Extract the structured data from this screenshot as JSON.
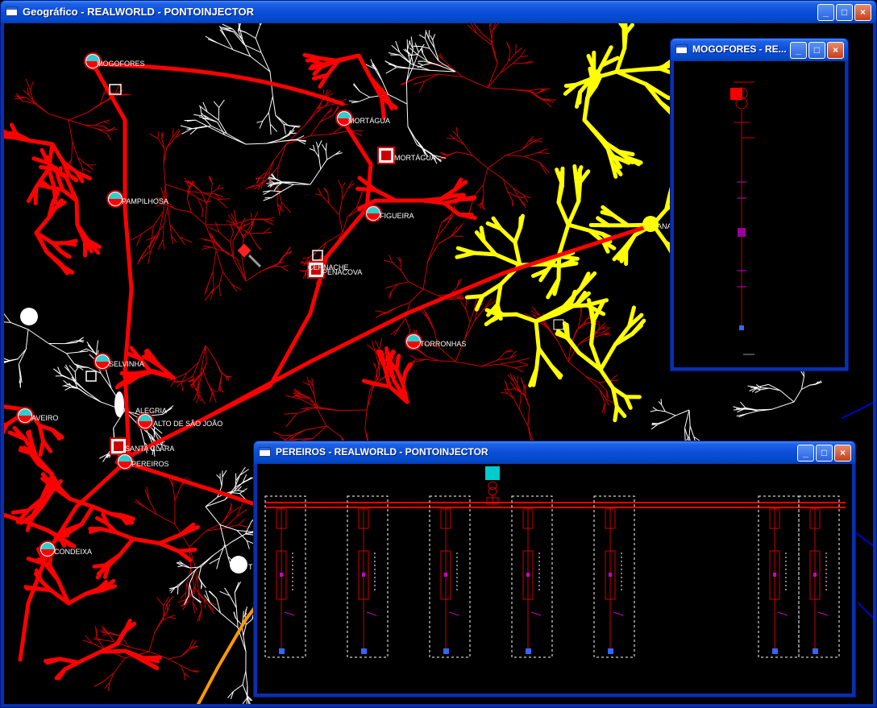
{
  "main_window": {
    "title": "Geográfico - REALWORLD - PONTOINJECTOR",
    "buttons": {
      "minimize": "_",
      "maximize": "□",
      "close": "×"
    }
  },
  "map": {
    "substations": [
      {
        "label": "MOGOFORES"
      },
      {
        "label": "MORTÁGUA"
      },
      {
        "label": "MORTÁGUA"
      },
      {
        "label": "ANADIA"
      },
      {
        "label": "PAMPILHOSA"
      },
      {
        "label": "FIGUEIRA"
      },
      {
        "label": "PENACOVA"
      },
      {
        "label": "CERNACHE"
      },
      {
        "label": "TORRONHAS"
      },
      {
        "label": "SELVINHA"
      },
      {
        "label": "ALEGRIA"
      },
      {
        "label": "AVEIRO"
      },
      {
        "label": "ALTO DE SÃO JOÃO"
      },
      {
        "label": "SANTA CLARA"
      },
      {
        "label": "PEREIROS"
      },
      {
        "label": "CONDEIXA"
      },
      {
        "label": "TUF"
      }
    ],
    "colors": {
      "network": "#ff0000",
      "highlight": "#ffff00",
      "lowvoltage": "#ffffff",
      "substation_fill": "#33cccc",
      "orange_line": "#ff9900",
      "blue_line": "#0000cc"
    }
  },
  "mogofores_window": {
    "title": "MOGOFORES - RE...",
    "buttons": {
      "minimize": "_",
      "maximize": "□",
      "close": "×"
    }
  },
  "pereiros_window": {
    "title": "PEREIROS - REALWORLD - PONTOINJECTOR",
    "buttons": {
      "minimize": "_",
      "maximize": "□",
      "close": "×"
    },
    "feeder_count": 7
  }
}
